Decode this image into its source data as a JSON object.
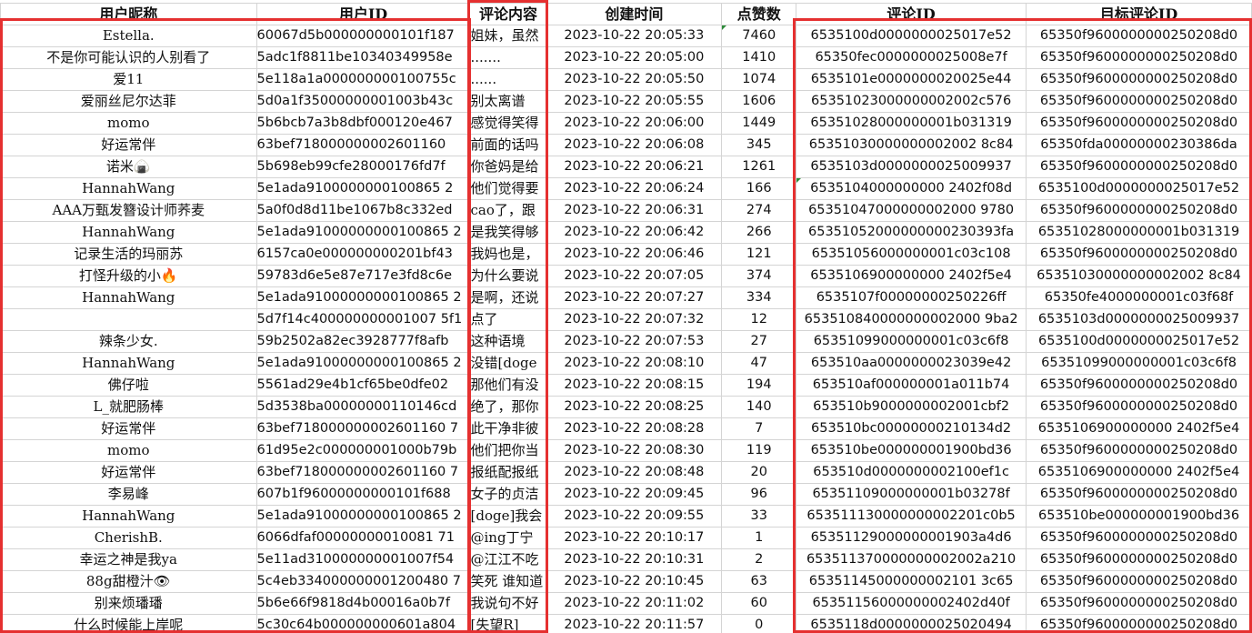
{
  "columns": [
    "用户昵称",
    "用户ID",
    "评论内容",
    "创建时间",
    "点赞数",
    "评论ID",
    "目标评论ID"
  ],
  "rows": [
    [
      "Estella.",
      "60067d5b000000000101f187",
      "姐妹，虽然",
      "2023-10-22 20:05:33",
      "7460",
      "6535100d0000000025017e52",
      "65350f9600000000250208d0"
    ],
    [
      "不是你可能认识的人别看了",
      "5adc1f8811be10340349958e",
      ".......",
      "2023-10-22 20:05:00",
      "1410",
      "65350fec0000000025008e7f",
      "65350f9600000000250208d0"
    ],
    [
      "爱11",
      "5e118a1a000000000100755c",
      "......",
      "2023-10-22 20:05:50",
      "1074",
      "6535101e0000000020025e44",
      "65350f9600000000250208d0"
    ],
    [
      "爱丽丝尼尔达菲",
      "5d0a1f35000000001003b43c",
      "别太离谱",
      "2023-10-22 20:05:55",
      "1606",
      "65351023000000002002c576",
      "65350f9600000000250208d0"
    ],
    [
      "momo",
      "5b6bcb7a3b8dbf000120e467",
      "感觉得笑得",
      "2023-10-22 20:06:00",
      "1449",
      "65351028000000001b031319",
      "65350f9600000000250208d0"
    ],
    [
      "好运常伴",
      "63bef718000000002601160",
      "前面的话吗",
      "2023-10-22 20:06:08",
      "345",
      "65351030000000002002 8c84",
      "65350fda00000000230386da"
    ],
    [
      "诺米🍙",
      "5b698eb99cfe28000176fd7f",
      "你爸妈是给",
      "2023-10-22 20:06:21",
      "1261",
      "6535103d0000000025009937",
      "65350f9600000000250208d0"
    ],
    [
      "HannahWang",
      "5e1ada9100000000100865 2",
      "他们觉得要",
      "2023-10-22 20:06:24",
      "166",
      "6535104000000000 2402f08d",
      "6535100d0000000025017e52"
    ],
    [
      "AAA万甄发簪设计师荞麦",
      "5a0f0d8d11be1067b8c332ed",
      "cao了，跟",
      "2023-10-22 20:06:31",
      "274",
      "65351047000000002000 9780",
      "65350f9600000000250208d0"
    ],
    [
      "HannahWang",
      "5e1ada91000000000100865 2",
      "是我笑得够",
      "2023-10-22 20:06:42",
      "266",
      "65351052000000000230393fa",
      "65351028000000001b031319"
    ],
    [
      "记录生活的玛丽苏",
      "6157ca0e000000000201bf43",
      "我妈也是，",
      "2023-10-22 20:06:46",
      "121",
      "65351056000000001c03c108",
      "65350f9600000000250208d0"
    ],
    [
      "打怪升级的小🔥",
      "59783d6e5e87e717e3fd8c6e",
      "为什么要说",
      "2023-10-22 20:07:05",
      "374",
      "6535106900000000 2402f5e4",
      "65351030000000002002 8c84"
    ],
    [
      "HannahWang",
      "5e1ada91000000000100865 2",
      "是啊，还说",
      "2023-10-22 20:07:27",
      "334",
      "6535107f00000000250226ff",
      "65350fe4000000001c03f68f"
    ],
    [
      "",
      "5d7f14c400000000001007 5f1",
      "点了",
      "2023-10-22 20:07:32",
      "12",
      "653510840000000002000 9ba2",
      "6535103d0000000025009937"
    ],
    [
      "辣条少女.",
      "59b2502a82ec3928777f8afb",
      "这种语境",
      "2023-10-22 20:07:53",
      "27",
      "65351099000000001c03c6f8",
      "6535100d0000000025017e52"
    ],
    [
      "HannahWang",
      "5e1ada91000000000100865 2",
      "没错[doge",
      "2023-10-22 20:08:10",
      "47",
      "653510aa0000000023039e42",
      "65351099000000001c03c6f8"
    ],
    [
      "佛仔啦",
      "5561ad29e4b1cf65be0dfe02",
      "那他们有没",
      "2023-10-22 20:08:15",
      "194",
      "653510af000000001a011b74",
      "65350f9600000000250208d0"
    ],
    [
      "L_就肥肠棒",
      "5d3538ba00000000110146cd",
      "绝了，那你",
      "2023-10-22 20:08:25",
      "140",
      "653510b9000000002001cbf2",
      "65350f9600000000250208d0"
    ],
    [
      "好运常伴",
      "63bef718000000002601160 7",
      "此干净非彼",
      "2023-10-22 20:08:28",
      "7",
      "653510bc00000000210134d2",
      "6535106900000000 2402f5e4"
    ],
    [
      "momo",
      "61d95e2c000000001000b79b",
      "他们把你当",
      "2023-10-22 20:08:30",
      "119",
      "653510be000000001900bd36",
      "65350f9600000000250208d0"
    ],
    [
      "好运常伴",
      "63bef718000000002601160 7",
      "报纸配报纸",
      "2023-10-22 20:08:48",
      "20",
      "653510d0000000002100ef1c",
      "6535106900000000 2402f5e4"
    ],
    [
      "李易峰",
      "607b1f96000000000101f688",
      "女子的贞洁",
      "2023-10-22 20:09:45",
      "96",
      "65351109000000001b03278f",
      "65350f9600000000250208d0"
    ],
    [
      "HannahWang",
      "5e1ada91000000000100865 2",
      "[doge]我会",
      "2023-10-22 20:09:55",
      "33",
      "653511130000000002201c0b5",
      "653510be000000001900bd36"
    ],
    [
      "CherishB.",
      "6066dfaf00000000010081 71",
      "@ing丁宁",
      "2023-10-22 20:10:17",
      "1",
      "65351129000000001903a4d6",
      "65350f9600000000250208d0"
    ],
    [
      "幸运之神是我ya",
      "5e11ad310000000001007f54",
      "@江江不吃",
      "2023-10-22 20:10:31",
      "2",
      "653511370000000002002a210",
      "65350f9600000000250208d0"
    ],
    [
      "88g甜橙汁👁",
      "5c4eb334000000001200480 7",
      "笑死 谁知道",
      "2023-10-22 20:10:45",
      "63",
      "65351145000000002101 3c65",
      "65350f9600000000250208d0"
    ],
    [
      "别来烦璠璠",
      "5b6e66f9818d4b00016a0b7f",
      "我说句不好",
      "2023-10-22 20:11:02",
      "60",
      "65351156000000002402d40f",
      "65350f9600000000250208d0"
    ],
    [
      "什么时候能上岸呢",
      "5c30c64b000000000601a804",
      "[失望R]",
      "2023-10-22 20:11:57",
      "0",
      "6535118d0000000025020494",
      "65350f9600000000250208d0"
    ]
  ]
}
